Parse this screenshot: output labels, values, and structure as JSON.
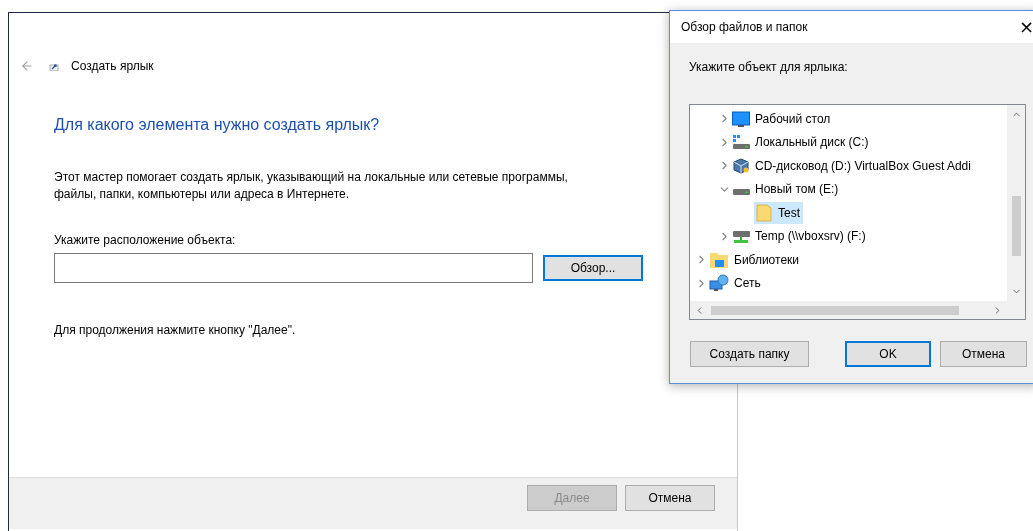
{
  "wizard": {
    "title": "Создать ярлык",
    "heading": "Для какого элемента нужно создать ярлык?",
    "description": "Этот мастер помогает создать ярлык, указывающий на локальные или сетевые программы, файлы, папки, компьютеры или адреса в Интернете.",
    "location_label": "Укажите расположение объекта:",
    "browse_button": {
      "label": "Обзор...",
      "default": true
    },
    "hint": "Для продолжения нажмите кнопку \"Далее\".",
    "footer_buttons": [
      {
        "label": "Далее",
        "disabled": true
      },
      {
        "label": "Отмена",
        "disabled": false
      }
    ]
  },
  "browse_dialog": {
    "title": "Обзор файлов и папок",
    "close": "×",
    "prompt": "Укажите объект для ярлыка:",
    "tree": {
      "upper_level_children": [
        {
          "label": "Рабочий стол",
          "kind": "desktop",
          "expanded": false,
          "selected": false
        },
        {
          "label": "Локальный диск (C:)",
          "kind": "system-disk",
          "expanded": false,
          "selected": false
        },
        {
          "label": "CD-дисковод (D:) VirtualBox Guest Addi",
          "kind": "cd",
          "expanded": false,
          "selected": false
        },
        {
          "label": "Новый том (E:)",
          "kind": "disk",
          "expanded": true,
          "selected": false,
          "children": [
            {
              "label": "Test",
              "kind": "folder",
              "selected": true
            }
          ]
        },
        {
          "label": "Temp (\\\\vboxsrv) (F:)",
          "kind": "net-drive",
          "expanded": false,
          "selected": false
        }
      ],
      "items": [
        {
          "label": "Библиотеки",
          "kind": "library",
          "expanded": false,
          "selected": false
        },
        {
          "label": "Сеть",
          "kind": "network",
          "expanded": false,
          "selected": false
        }
      ]
    },
    "buttons": [
      {
        "label": "Создать папку",
        "default": false
      },
      {
        "label": "OK",
        "default": true
      },
      {
        "label": "Отмена",
        "default": false
      }
    ]
  }
}
